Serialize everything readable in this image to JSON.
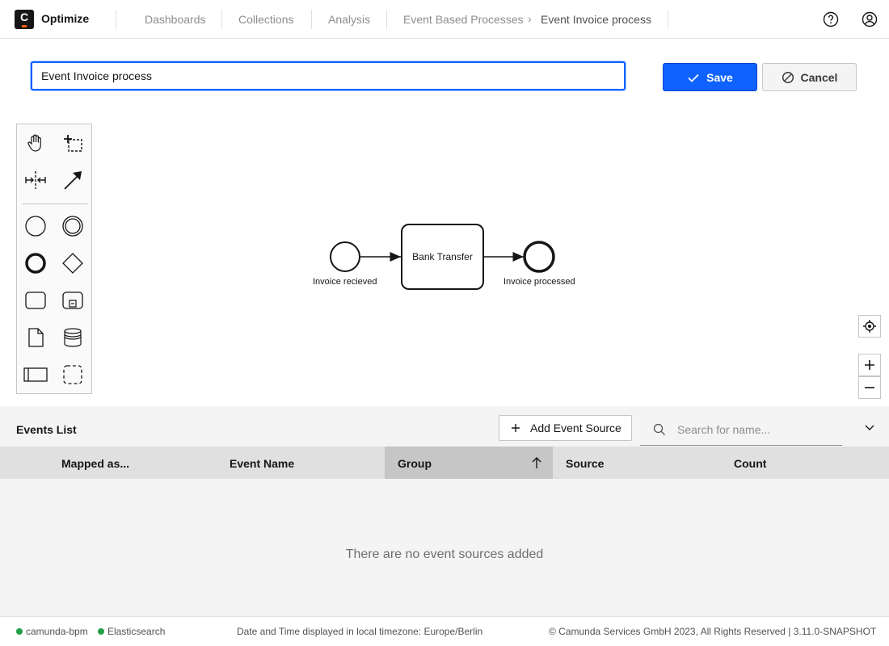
{
  "header": {
    "logo_letter": "C",
    "app_name": "Optimize",
    "nav": [
      "Dashboards",
      "Collections",
      "Analysis"
    ],
    "breadcrumb": {
      "parent": "Event Based Processes",
      "separator": "›",
      "current": "Event Invoice process"
    }
  },
  "editor": {
    "name_value": "Event Invoice process",
    "save_label": "Save",
    "cancel_label": "Cancel"
  },
  "diagram": {
    "start_event_label": "Invoice recieved",
    "task_label": "Bank Transfer",
    "end_event_label": "Invoice processed"
  },
  "events": {
    "title": "Events List",
    "add_source_label": "Add Event Source",
    "search_placeholder": "Search for name...",
    "columns": [
      "Mapped as...",
      "Event Name",
      "Group",
      "Source",
      "Count"
    ],
    "sorted_column": "Group",
    "empty_message": "There are no event sources added"
  },
  "footer": {
    "status_items": [
      "camunda-bpm",
      "Elasticsearch"
    ],
    "status_color": "#24a148",
    "timezone_text": "Date and Time displayed in local timezone: Europe/Berlin",
    "copyright": "© Camunda Services GmbH 2023, All Rights Reserved | 3.11.0-SNAPSHOT"
  },
  "colors": {
    "primary": "#0f62fe",
    "brand_orange": "#fc5d0d"
  },
  "icons": {
    "help": "help-icon",
    "user": "user-icon",
    "save": "checkmark-icon",
    "cancel": "cancel-icon",
    "search": "search-icon",
    "collapse": "chevron-down-icon",
    "add": "plus-icon",
    "sort": "arrow-up-icon"
  }
}
